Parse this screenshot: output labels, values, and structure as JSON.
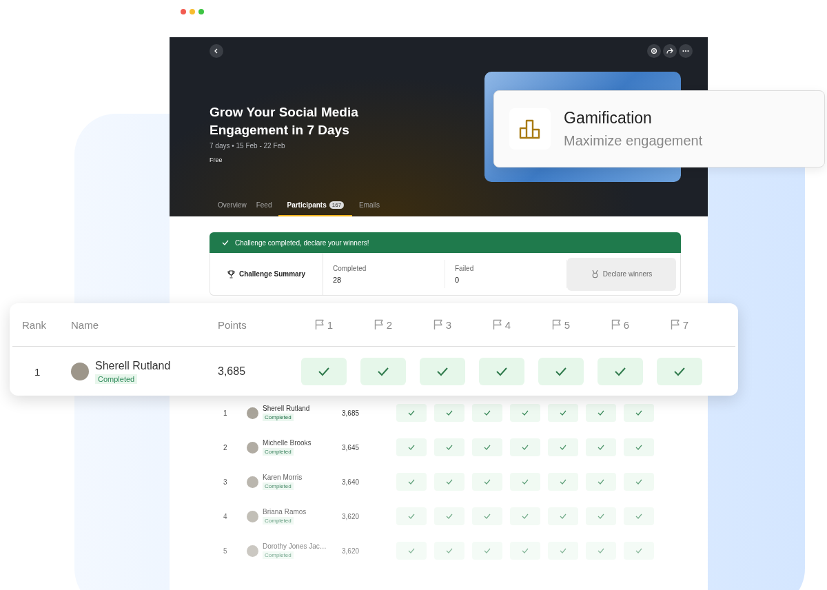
{
  "header": {
    "title": "Grow Your Social Media Engagement in 7 Days",
    "meta": "7 days • 15 Feb - 22 Feb",
    "price": "Free"
  },
  "tabs": [
    {
      "label": "Overview",
      "selected": false
    },
    {
      "label": "Feed",
      "selected": false
    },
    {
      "label": "Participants",
      "count": "167",
      "selected": true
    },
    {
      "label": "Emails",
      "selected": false
    }
  ],
  "notice": "Challenge completed, declare your winners!",
  "summary": {
    "title": "Challenge Summary",
    "stats": [
      {
        "label": "Completed",
        "value": "28"
      },
      {
        "label": "Failed",
        "value": "0"
      }
    ],
    "button": "Declare winners"
  },
  "feature_card": {
    "title": "Gamification",
    "subtitle": "Maximize engagement"
  },
  "highlight": {
    "columns": [
      "Rank",
      "Name",
      "Points"
    ],
    "days": [
      "1",
      "2",
      "3",
      "4",
      "5",
      "6",
      "7"
    ],
    "row": {
      "rank": "1",
      "name": "Sherell Rutland",
      "status": "Completed",
      "points": "3,685",
      "checks": [
        true,
        true,
        true,
        true,
        true,
        true,
        true
      ]
    }
  },
  "rows": [
    {
      "rank": "1",
      "name": "Sherell Rutland",
      "status": "Completed",
      "points": "3,685",
      "checks": [
        true,
        true,
        true,
        true,
        true,
        true,
        true
      ]
    },
    {
      "rank": "2",
      "name": "Michelle Brooks",
      "status": "Completed",
      "points": "3,645",
      "checks": [
        true,
        true,
        true,
        true,
        true,
        true,
        true
      ]
    },
    {
      "rank": "3",
      "name": "Karen Morris",
      "status": "Completed",
      "points": "3,640",
      "checks": [
        true,
        true,
        true,
        true,
        true,
        true,
        true
      ]
    },
    {
      "rank": "4",
      "name": "Briana Ramos",
      "status": "Completed",
      "points": "3,620",
      "checks": [
        true,
        true,
        true,
        true,
        true,
        true,
        true
      ]
    },
    {
      "rank": "5",
      "name": "Dorothy Jones Jac…",
      "status": "Completed",
      "points": "3,620",
      "checks": [
        true,
        true,
        true,
        true,
        true,
        true,
        true
      ]
    }
  ]
}
